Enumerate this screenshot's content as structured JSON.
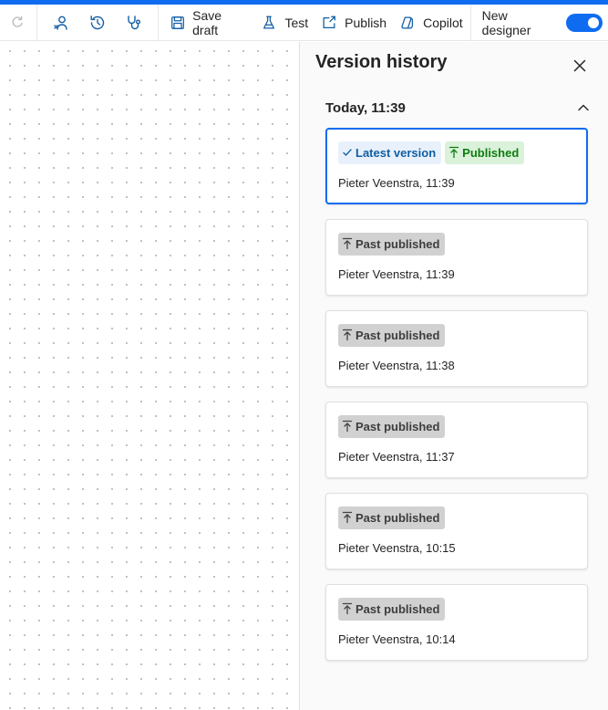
{
  "toolbar": {
    "buttons": [
      {
        "label": "Save draft",
        "icon": "save-icon"
      },
      {
        "label": "Test",
        "icon": "flask-icon"
      },
      {
        "label": "Publish",
        "icon": "publish-icon"
      },
      {
        "label": "Copilot",
        "icon": "copilot-icon"
      }
    ],
    "toggle_label": "New designer",
    "toggle_on": true,
    "accent_color": "#0f6cf0"
  },
  "panel": {
    "title": "Version history",
    "section": {
      "label": "Today, 11:39",
      "expanded": true
    },
    "versions": [
      {
        "badges": [
          "Latest version",
          "Published"
        ],
        "meta": "Pieter Veenstra, 11:39",
        "selected": true
      },
      {
        "badges": [
          "Past published"
        ],
        "meta": "Pieter Veenstra, 11:39"
      },
      {
        "badges": [
          "Past published"
        ],
        "meta": "Pieter Veenstra, 11:38"
      },
      {
        "badges": [
          "Past published"
        ],
        "meta": "Pieter Veenstra, 11:37"
      },
      {
        "badges": [
          "Past published"
        ],
        "meta": "Pieter Veenstra, 10:15"
      },
      {
        "badges": [
          "Past published"
        ],
        "meta": "Pieter Veenstra, 10:14"
      }
    ]
  }
}
